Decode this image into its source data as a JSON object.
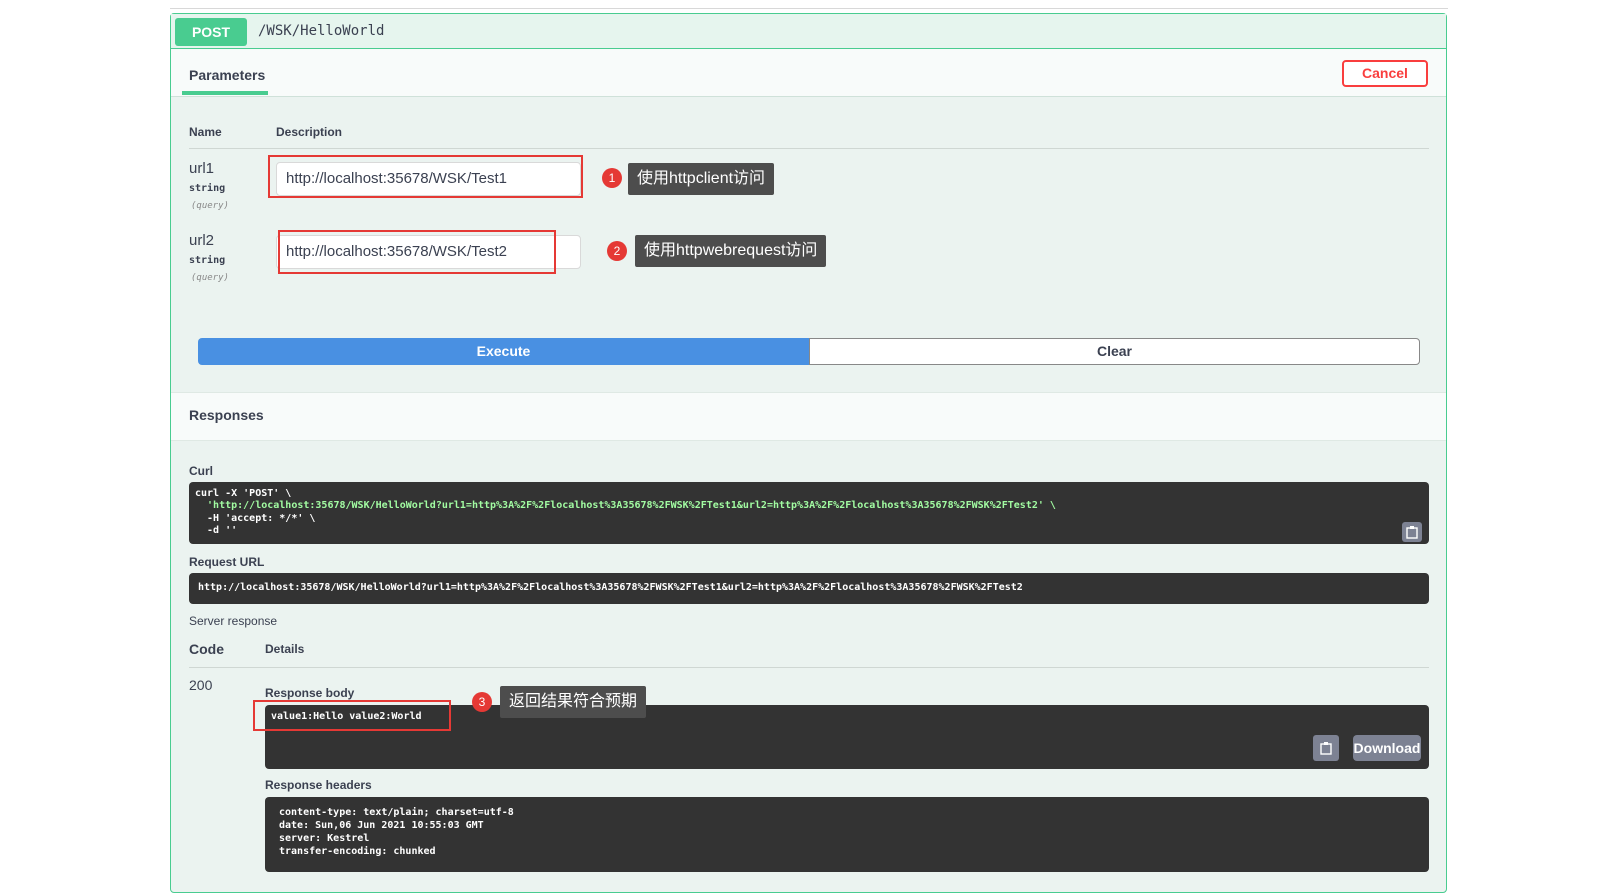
{
  "operation": {
    "method": "POST",
    "path": "/WSK/HelloWorld"
  },
  "tabs": {
    "parameters": "Parameters",
    "cancel": "Cancel"
  },
  "param_table": {
    "name_header": "Name",
    "description_header": "Description"
  },
  "params": [
    {
      "name": "url1",
      "type": "string",
      "in": "(query)",
      "value": "http://localhost:35678/WSK/Test1"
    },
    {
      "name": "url2",
      "type": "string",
      "in": "(query)",
      "value": "http://localhost:35678/WSK/Test2"
    }
  ],
  "annotations": [
    {
      "num": "1",
      "text": "使用httpclient访问"
    },
    {
      "num": "2",
      "text": "使用httpwebrequest访问"
    },
    {
      "num": "3",
      "text": "返回结果符合预期"
    }
  ],
  "buttons": {
    "execute": "Execute",
    "clear": "Clear",
    "download": "Download"
  },
  "responses": {
    "title": "Responses",
    "curl_label": "Curl",
    "curl_lines": [
      "curl -X 'POST' \\",
      "  'http://localhost:35678/WSK/HelloWorld?url1=http%3A%2F%2Flocalhost%3A35678%2FWSK%2FTest1&url2=http%3A%2F%2Flocalhost%3A35678%2FWSK%2FTest2' \\",
      "  -H 'accept: */*' \\",
      "  -d ''"
    ],
    "request_url_label": "Request URL",
    "request_url": "http://localhost:35678/WSK/HelloWorld?url1=http%3A%2F%2Flocalhost%3A35678%2FWSK%2FTest1&url2=http%3A%2F%2Flocalhost%3A35678%2FWSK%2FTest2",
    "server_response_label": "Server response",
    "code_header": "Code",
    "details_header": "Details",
    "code": "200",
    "response_body_label": "Response body",
    "response_body": "value1:Hello value2:World",
    "response_headers_label": "Response headers",
    "response_headers": [
      "content-type: text/plain; charset=utf-8",
      "date: Sun,06 Jun 2021 10:55:03 GMT",
      "server: Kestrel",
      "transfer-encoding: chunked"
    ]
  },
  "colors": {
    "post_green": "#49cc90",
    "execute_blue": "#4990e2",
    "cancel_red": "#f93e3e",
    "annotation_red": "#e53935"
  }
}
